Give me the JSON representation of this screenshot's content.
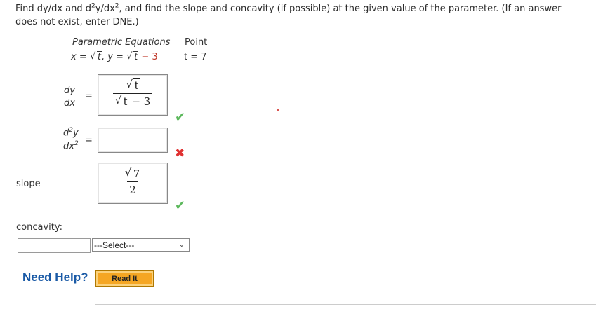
{
  "prompt": {
    "part1": "Find dy/dx and d",
    "sup1": "2",
    "part2": "y/dx",
    "sup2": "2",
    "part3": ", and find the slope and concavity (if possible) at the given value of the parameter. (If an answer does not exist, enter DNE.)"
  },
  "table": {
    "header_equations": "Parametric Equations",
    "header_point": "Point",
    "eq_x": "x = ",
    "eq_x_rad": "t",
    "eq_sep": ",   y = ",
    "eq_y_rad": "t",
    "eq_y_rest": " − 3",
    "point": "t = 7"
  },
  "dydx": {
    "num": "dy",
    "den": "dx",
    "equals": "=",
    "answer_num_rad": "t",
    "answer_den_rad": "t",
    "answer_den_rest": " − 3",
    "status": "correct"
  },
  "d2ydx2": {
    "num": "d",
    "num_sup": "2",
    "num_rest": "y",
    "den": "dx",
    "den_sup": "2",
    "equals": "=",
    "answer": "",
    "status": "incorrect"
  },
  "slope": {
    "label": "slope",
    "answer_num_rad": "7",
    "answer_den": "2",
    "status": "correct"
  },
  "concavity": {
    "label": "concavity:",
    "input_value": "",
    "select_value": "---Select---"
  },
  "help": {
    "label": "Need Help?",
    "read_it": "Read It"
  },
  "colors": {
    "correct": "#5cb85c",
    "incorrect": "#e03131",
    "link": "#1a5aa6",
    "button": "#f5a623"
  },
  "icons": {
    "correct": "check-icon",
    "incorrect": "cross-icon",
    "dropdown": "chevron-down-icon"
  }
}
